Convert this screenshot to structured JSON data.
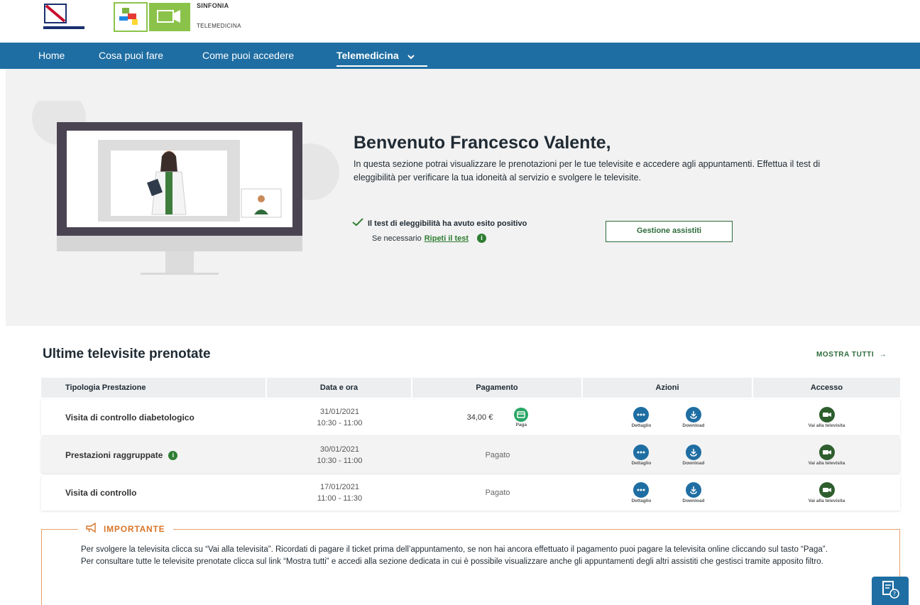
{
  "brand": {
    "name": "SINFONIA",
    "sub": "TELEMEDICINA"
  },
  "nav": {
    "items": [
      "Home",
      "Cosa puoi fare",
      "Come puoi accedere",
      "Telemedicina"
    ]
  },
  "hero": {
    "title": "Benvenuto Francesco Valente,",
    "description": "In questa sezione potrai visualizzare le prenotazioni per le tue televisite e accedere agli appuntamenti. Effettua il test di eleggibilità per verificare la tua idoneità al servizio e svolgere le televisite.",
    "eligibility_status": "Il test di eleggibilità ha avuto esito positivo",
    "retest_prefix": "Se necessario",
    "retest_link": "Ripeti il test",
    "assistiti_button": "Gestione assistiti"
  },
  "visits": {
    "title": "Ultime televisite prenotate",
    "show_all": "MOSTRA TUTTI",
    "columns": [
      "Tipologia Prestazione",
      "Data e ora",
      "Pagamento",
      "Azioni",
      "Accesso"
    ],
    "rows": [
      {
        "type": "Visita di controllo diabetologico",
        "date": "31/01/2021",
        "time": "10:30 - 11:00",
        "payment": "34,00 €",
        "pay_label": "Paga",
        "detail": "Dettaglio",
        "download": "Download",
        "access": "Vai alla televisita"
      },
      {
        "type": "Prestazioni raggruppate",
        "date": "30/01/2021",
        "time": "10:30 - 11:00",
        "payment": "Pagato",
        "detail": "Dettaglio",
        "download": "Download",
        "access": "Vai alla televisita"
      },
      {
        "type": "Visita di controllo",
        "date": "17/01/2021",
        "time": "11:00 - 11:30",
        "payment": "Pagato",
        "detail": "Dettaglio",
        "download": "Download",
        "access": "Vai alla televisita"
      }
    ]
  },
  "important": {
    "title": "IMPORTANTE",
    "text1": "Per svolgere la televisita clicca su “Vai alla televisita”. Ricordati di pagare il ticket prima dell’appuntamento, se non hai ancora effettuato il pagamento puoi pagare la televisita online cliccando sul tasto “Paga”.",
    "text2": "Per consultare tutte le televisite prenotate clicca sul link “Mostra tutti” e accedi alla sezione dedicata in cui è possibile visualizzare anche gli appuntamenti degli altri assistiti che gestisci tramite apposito filtro."
  },
  "colors": {
    "primary": "#1f6ea3",
    "green": "#2e6b3a",
    "orange": "#d97528",
    "pay": "#2aa665"
  },
  "icons": [
    "region-logo",
    "sinfonia-logo",
    "chevron-down-icon",
    "check-icon",
    "info-icon",
    "pay-icon",
    "detail-icon",
    "download-icon",
    "video-icon",
    "megaphone-icon",
    "help-doc-icon"
  ]
}
